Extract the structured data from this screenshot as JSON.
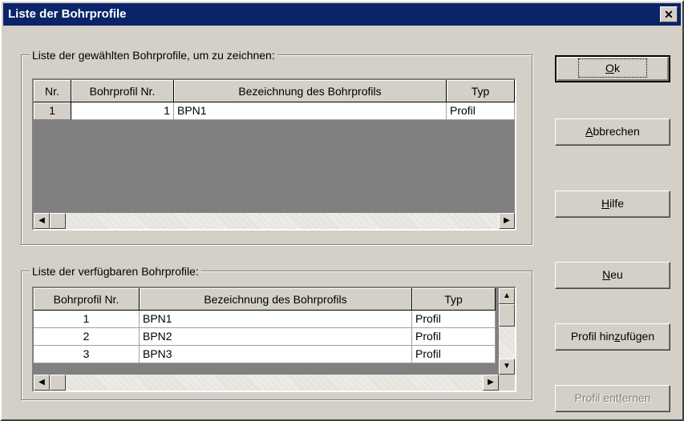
{
  "window": {
    "title": "Liste der Bohrprofile",
    "close_glyph": "✕"
  },
  "selected_group": {
    "legend": "Liste der gewählten Bohrprofile, um zu zeichnen:",
    "columns": [
      "Nr.",
      "Bohrprofil Nr.",
      "Bezeichnung des Bohrprofils",
      "Typ"
    ],
    "rows": [
      {
        "nr": "1",
        "profil_nr": "1",
        "bezeichnung": "BPN1",
        "typ": "Profil"
      }
    ]
  },
  "available_group": {
    "legend": "Liste der verfügbaren Bohrprofile:",
    "columns": [
      "Bohrprofil Nr.",
      "Bezeichnung des Bohrprofils",
      "Typ"
    ],
    "rows": [
      {
        "profil_nr": "1",
        "bezeichnung": "BPN1",
        "typ": "Profil"
      },
      {
        "profil_nr": "2",
        "bezeichnung": "BPN2",
        "typ": "Profil"
      },
      {
        "profil_nr": "3",
        "bezeichnung": "BPN3",
        "typ": "Profil"
      }
    ]
  },
  "buttons": {
    "ok": {
      "pre": "",
      "u": "O",
      "post": "k"
    },
    "cancel": {
      "pre": "",
      "u": "A",
      "post": "bbrechen"
    },
    "help": {
      "pre": "",
      "u": "H",
      "post": "ilfe"
    },
    "new": {
      "pre": "",
      "u": "N",
      "post": "eu"
    },
    "add": {
      "pre": "Profil hin",
      "u": "z",
      "post": "ufügen"
    },
    "remove": {
      "pre": "Profil ent",
      "u": "f",
      "post": "ernen"
    }
  },
  "scroll_glyphs": {
    "left": "◀",
    "right": "▶",
    "up": "▲",
    "down": "▼"
  }
}
